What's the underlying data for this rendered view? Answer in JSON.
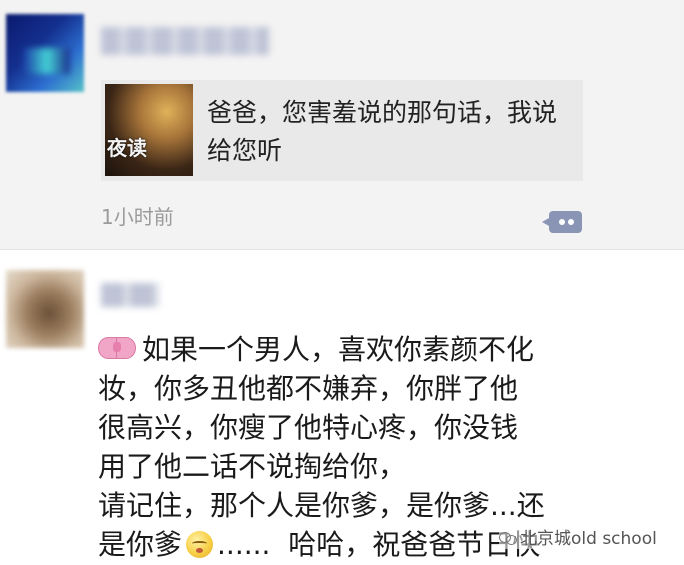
{
  "post1": {
    "shared_link": {
      "thumbnail_label": "夜读",
      "title": "爸爸，您害羞说的那句话，我说给您听"
    },
    "timestamp": "1小时前"
  },
  "post2": {
    "line1": "如果一个男人，喜欢你素颜不化",
    "line2": "妆，你多丑他都不嫌弃，你胖了他",
    "line3": "很高兴，你瘦了他特心疼，你没钱",
    "line4": "用了他二话不说掏给你，",
    "line5": "请记住，那个人是你爹，是你爹...还",
    "line6_a": "是你爹",
    "line6_b": "......  哈哈，祝爸爸节日快"
  },
  "watermark": "北京城old school",
  "icons": {
    "comment": "comment-icon",
    "bow": "ribbon-bow-emoji",
    "face": "embarrassed-face-emoji",
    "watermark": "wechat-icon"
  }
}
